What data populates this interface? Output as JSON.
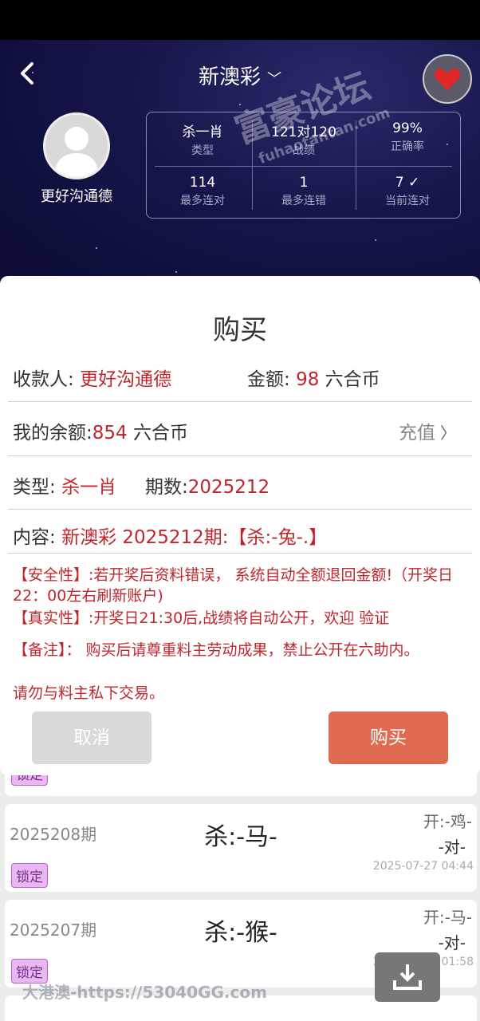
{
  "header": {
    "title": "新澳彩",
    "username": "更好沟通德",
    "stats": [
      {
        "value": "杀一肖",
        "label": "类型"
      },
      {
        "value": "121对120",
        "label": "战绩"
      },
      {
        "value": "99%",
        "label": "正确率"
      },
      {
        "value": "114",
        "label": "最多连对"
      },
      {
        "value": "1",
        "label": "最多连错"
      },
      {
        "value": "7 ✓",
        "label": "当前连对"
      }
    ]
  },
  "modal": {
    "title": "购买",
    "payee_label": "收款人: ",
    "payee": "更好沟通德",
    "amount_label": "金额: ",
    "amount": "98",
    "amount_unit": " 六合币",
    "balance_label": "我的余额:",
    "balance": "854",
    "balance_unit": " 六合币",
    "recharge": "充值",
    "type_label": "类型: ",
    "type": "杀一肖",
    "period_label": "期数:",
    "period": "2025212",
    "content_label": "内容: ",
    "content": "新澳彩 2025212期:【杀:-兔-.】",
    "notice_safety": "【安全性】:若开奖后资料错误， 系统自动全额退回金额!（开奖日22：00左右刷新账户)",
    "notice_real": "【真实性】:开奖日21:30后,战绩将自动公开，欢迎 验证",
    "notice_remark": "【备注】： 购买后请尊重料主劳动成果，禁止公开在六助内。",
    "notice_private": "请勿与料主私下交易。",
    "cancel": "取消",
    "buy": "购买"
  },
  "list": {
    "lock_label": "锁定",
    "items": [
      {
        "period": "2025208期",
        "kill": "杀:-马-",
        "open": "开:-鸡-",
        "result": "-对-",
        "date": "2025-07-27 04:44"
      },
      {
        "period": "2025207期",
        "kill": "杀:-猴-",
        "open": "开:-马-",
        "result": "-对-",
        "date": "2025-07-26 01:58"
      }
    ]
  },
  "watermarks": {
    "bottom": "大港澳-https://53040GG.com",
    "forum": "富豪论坛",
    "domain": "fuhaotantan.com"
  }
}
